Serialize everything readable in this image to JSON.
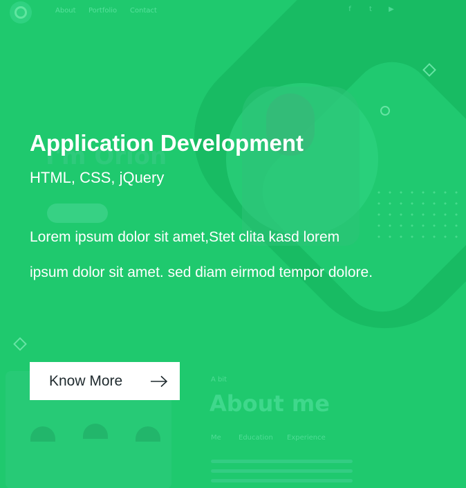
{
  "nav": {
    "links": [
      "About",
      "Portfolio",
      "Contact"
    ],
    "social_icons": [
      "facebook-icon",
      "twitter-icon",
      "youtube-icon"
    ]
  },
  "background": {
    "ghost_name": "I'm Orion",
    "about_eyebrow": "A bit",
    "about_title": "About me",
    "about_tabs": [
      "Me",
      "Education",
      "Experience"
    ]
  },
  "slide": {
    "title": "Application Development",
    "subtitle": "HTML, CSS, jQuery",
    "description": "Lorem ipsum dolor sit amet,Stet clita kasd lorem ipsum dolor sit amet. sed diam  eirmod tempor dolore.",
    "cta_label": "Know More"
  },
  "colors": {
    "overlay": "#1fc96e",
    "text": "#ffffff",
    "button_bg": "#ffffff",
    "button_text": "#1f2a2e"
  }
}
